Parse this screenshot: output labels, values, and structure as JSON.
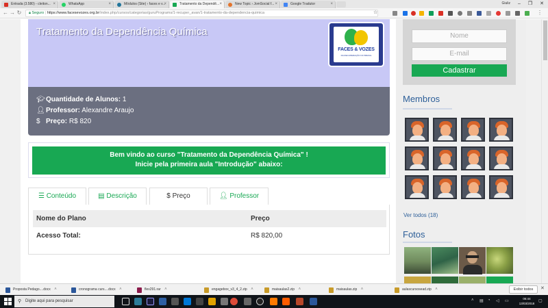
{
  "browser": {
    "tabs": [
      {
        "title": "Entrada (3.580) - cleiton...",
        "color": "#d93025",
        "active": false
      },
      {
        "title": "WhatsApp",
        "color": "#25d366",
        "active": false
      },
      {
        "title": "Módulos (Site) ‹ faces e v...",
        "color": "#21759b",
        "active": false
      },
      {
        "title": "Tratamento da Dependê...",
        "color": "#18a853",
        "active": true
      },
      {
        "title": "New Topic › JomSocial f...",
        "color": "#e3742c",
        "active": false
      },
      {
        "title": "Google Tradutor",
        "color": "#4285f4",
        "active": false
      }
    ],
    "user": "Giuliz",
    "secure_label": "Seguro",
    "url_host": "https://www.facesevozes.org.br",
    "url_path": "/index.php/cursos/categorias/guruPrograms/1-recuper_avan/1-tratamento-da-dependencia-quimica",
    "window_buttons": {
      "minimize": "–",
      "maximize": "❐",
      "close": "✕"
    }
  },
  "course": {
    "title": "Tratamento da Dependência Química",
    "logo_text": "FACES & VOZES",
    "logo_sub": "DA RECUPERAÇÃO NO BRASIL",
    "students_label": "Quantidade de Alunos:",
    "students_value": "1",
    "professor_label": "Professor:",
    "professor_value": "Alexandre Araujo",
    "price_label": "Preço:",
    "price_value": "R$ 820",
    "icons": {
      "students": "graduation-cap-icon",
      "professor": "user-icon",
      "price": "dollar-icon"
    },
    "welcome_line1": "Bem vindo ao curso \"Tratamento da Dependência Química\" !",
    "welcome_line2": "Inicie pela primeira aula \"Introdução\" abaixo:",
    "tabs": [
      {
        "label": "Conteúdo",
        "icon": "list-icon",
        "active": false
      },
      {
        "label": "Descrição",
        "icon": "document-icon",
        "active": false
      },
      {
        "label": "Preço",
        "icon": "dollar-icon",
        "active": true
      },
      {
        "label": "Professor",
        "icon": "user-icon",
        "active": false
      }
    ],
    "price_table": {
      "headers": [
        "Nome do Plano",
        "Preço"
      ],
      "rows": [
        [
          "Acesso Total:",
          "R$ 820,00"
        ]
      ]
    }
  },
  "sidebar": {
    "name_placeholder": "Nome",
    "email_placeholder": "E-mail",
    "register_button": "Cadastrar",
    "members_heading": "Membros",
    "member_count_shown": 12,
    "see_all": "Ver todos (18)",
    "photos_heading": "Fotos"
  },
  "downloads": [
    {
      "name": "Proposta Pedago....docx",
      "color": "#2b579a"
    },
    {
      "name": "cronograma curs....docx",
      "color": "#2b579a"
    },
    {
      "name": "flex291.rar",
      "color": "#8b1a4a"
    },
    {
      "name": "engagebox_v3_4_2.zip",
      "color": "#c89b2a"
    },
    {
      "name": "maisaulas2.zip",
      "color": "#c89b2a"
    },
    {
      "name": "maisaulas.zip",
      "color": "#c89b2a"
    },
    {
      "name": "aulascursosead.zip",
      "color": "#c89b2a"
    }
  ],
  "downloads_show_all": "Exibir todos",
  "taskbar": {
    "search_placeholder": "Digite aqui para pesquisar",
    "time": "06:44",
    "date": "13/03/2018"
  },
  "colors": {
    "accent_green": "#18a853",
    "hero_lavender": "#c8c8f6",
    "info_slate": "#6b6f80",
    "link_blue": "#2c5e98"
  }
}
